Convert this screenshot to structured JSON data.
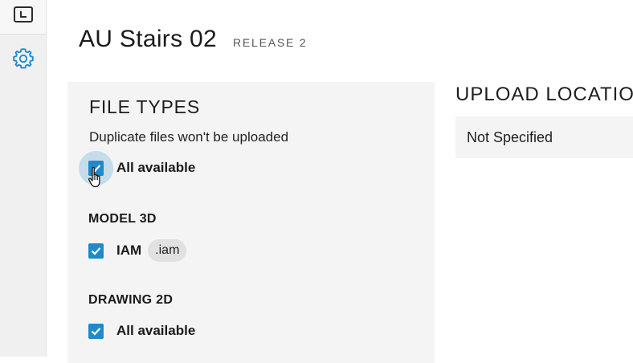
{
  "project": {
    "title": "AU Stairs 02",
    "release": "RELEASE 2"
  },
  "sidebar": {
    "items": [
      {
        "icon": "document-frame-icon"
      },
      {
        "icon": "gear-icon"
      }
    ]
  },
  "file_types": {
    "heading": "FILE TYPES",
    "helper": "Duplicate files won't be uploaded",
    "all_available": {
      "label": "All available",
      "checked": true
    },
    "groups": [
      {
        "heading": "MODEL 3D",
        "items": [
          {
            "label": "IAM",
            "extension": ".iam",
            "checked": true
          }
        ]
      },
      {
        "heading": "DRAWING 2D",
        "items": [
          {
            "label": "All available",
            "checked": true
          }
        ]
      }
    ]
  },
  "upload_location": {
    "heading": "UPLOAD LOCATION",
    "value": "Not Specified"
  },
  "colors": {
    "accent": "#1f8acb",
    "panel": "#f4f4f4",
    "rail": "#f0f0f0"
  }
}
